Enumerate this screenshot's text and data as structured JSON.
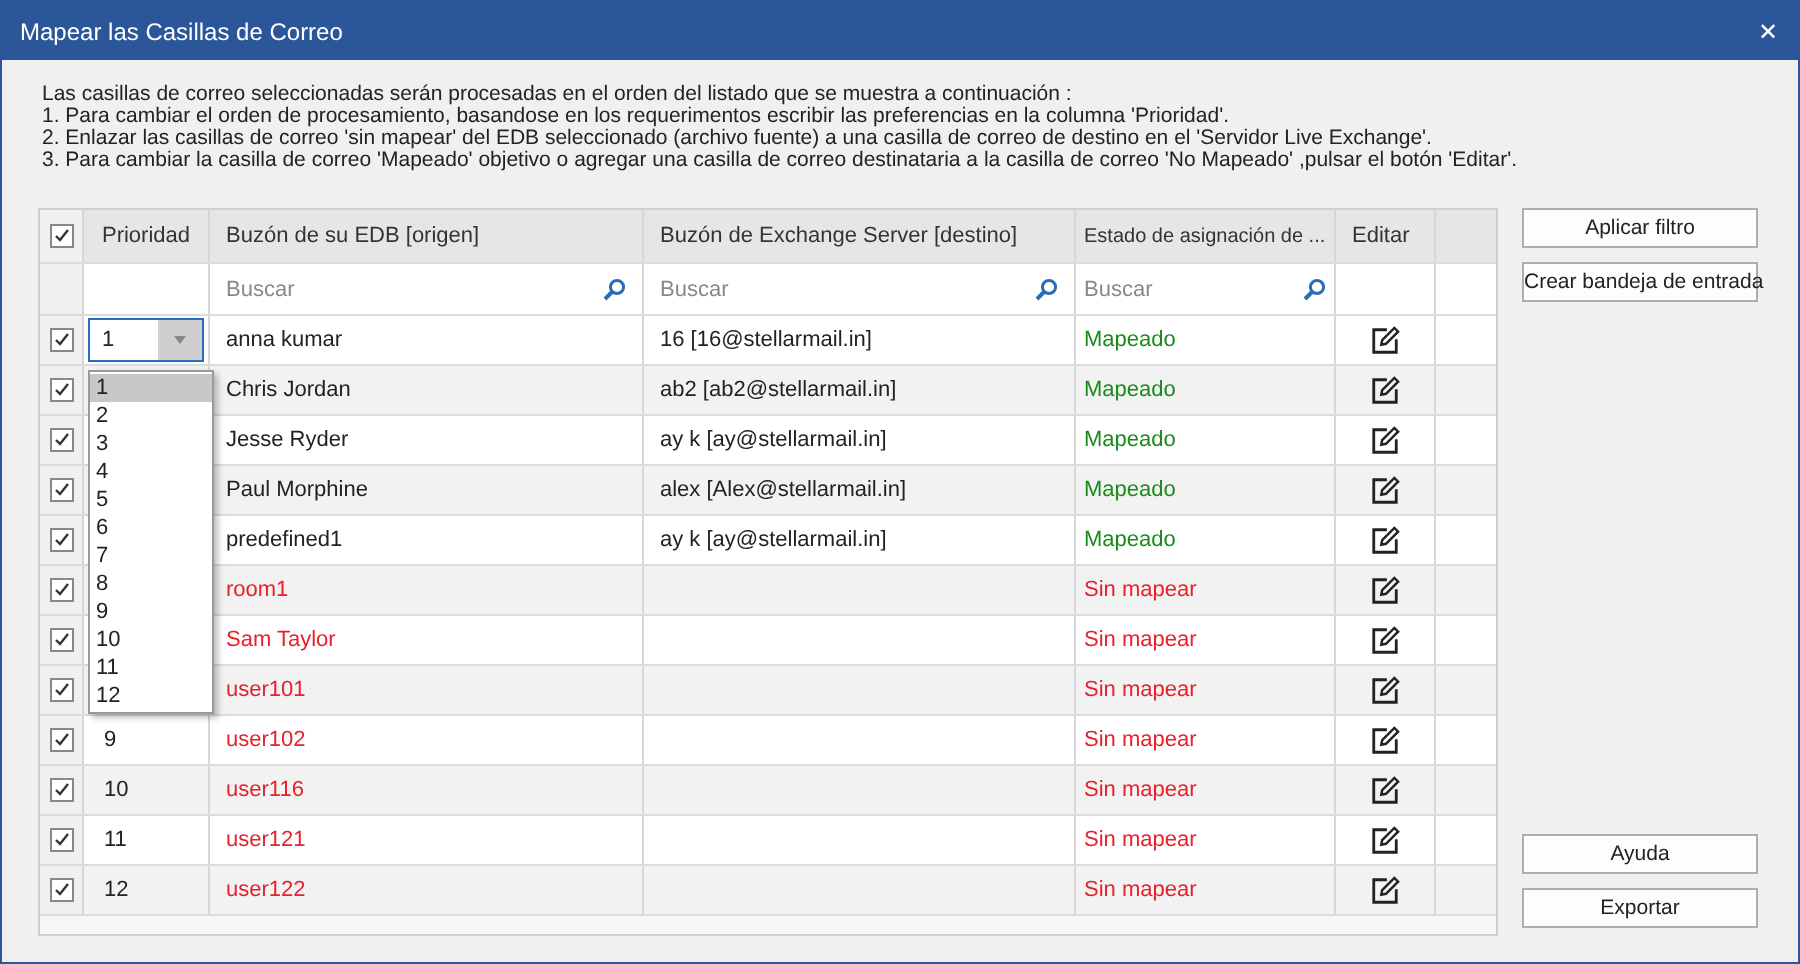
{
  "window": {
    "title": "Mapear las Casillas de Correo",
    "close": "✕"
  },
  "instructions": [
    "Las casillas de correo seleccionadas serán procesadas en el orden del listado que se muestra a continuación :",
    "1. Para cambiar el orden de procesamiento, basandose en los requerimentos escribir las preferencias en la columna 'Prioridad'.",
    "2. Enlazar las casillas de correo 'sin mapear' del EDB seleccionado (archivo fuente) a una casilla de correo de destino en el 'Servidor Live Exchange'.",
    "3. Para cambiar la casilla de correo 'Mapeado' objetivo o agregar una casilla de correo destinataria a la casilla de correo 'No Mapeado' ,pulsar el botón 'Editar'."
  ],
  "table": {
    "select_all": {
      "checked": true
    },
    "columns": [
      "Prioridad",
      "Buzón de su EDB [origen]",
      "Buzón de Exchange Server [destino]",
      "Estado de asignación de ...",
      "Editar"
    ],
    "search_placeholders": [
      "Buscar",
      "Buscar",
      "Buscar"
    ],
    "rows": [
      {
        "checked": true,
        "priority": "1",
        "source": "anna kumar",
        "target": "16 [16@stellarmail.in]",
        "status": "Mapeado",
        "mapped": true
      },
      {
        "checked": true,
        "source": "Chris Jordan",
        "target": "ab2 [ab2@stellarmail.in]",
        "status": "Mapeado",
        "mapped": true
      },
      {
        "checked": true,
        "source": "Jesse Ryder",
        "target": "ay k [ay@stellarmail.in]",
        "status": "Mapeado",
        "mapped": true
      },
      {
        "checked": true,
        "source": "Paul Morphine",
        "target": "alex [Alex@stellarmail.in]",
        "status": "Mapeado",
        "mapped": true
      },
      {
        "checked": true,
        "source": "predefined1",
        "target": "ay k [ay@stellarmail.in]",
        "status": "Mapeado",
        "mapped": true
      },
      {
        "checked": true,
        "source": "room1",
        "status": "Sin mapear",
        "mapped": false
      },
      {
        "checked": true,
        "source": "Sam Taylor",
        "status": "Sin mapear",
        "mapped": false
      },
      {
        "checked": true,
        "source": "user101",
        "status": "Sin mapear",
        "mapped": false
      },
      {
        "checked": true,
        "priority": "9",
        "source": "user102",
        "status": "Sin mapear",
        "mapped": false
      },
      {
        "checked": true,
        "priority": "10",
        "source": "user116",
        "status": "Sin mapear",
        "mapped": false
      },
      {
        "checked": true,
        "priority": "11",
        "source": "user121",
        "status": "Sin mapear",
        "mapped": false
      },
      {
        "checked": true,
        "priority": "12",
        "source": "user122",
        "status": "Sin mapear",
        "mapped": false
      }
    ]
  },
  "priority_dropdown": {
    "options": [
      {
        "label": "1",
        "selected": true
      },
      {
        "label": "2",
        "selected": false
      },
      {
        "label": "3",
        "selected": false
      },
      {
        "label": "4",
        "selected": false
      },
      {
        "label": "5",
        "selected": false
      },
      {
        "label": "6",
        "selected": false
      },
      {
        "label": "7",
        "selected": false
      },
      {
        "label": "8",
        "selected": false
      },
      {
        "label": "9",
        "selected": false
      },
      {
        "label": "10",
        "selected": false
      },
      {
        "label": "11",
        "selected": false
      },
      {
        "label": "12",
        "selected": false
      }
    ]
  },
  "buttons_top": [
    "Aplicar filtro",
    "Crear bandeja de entrada"
  ],
  "buttons_bottom": [
    "Ayuda",
    "Exportar"
  ]
}
